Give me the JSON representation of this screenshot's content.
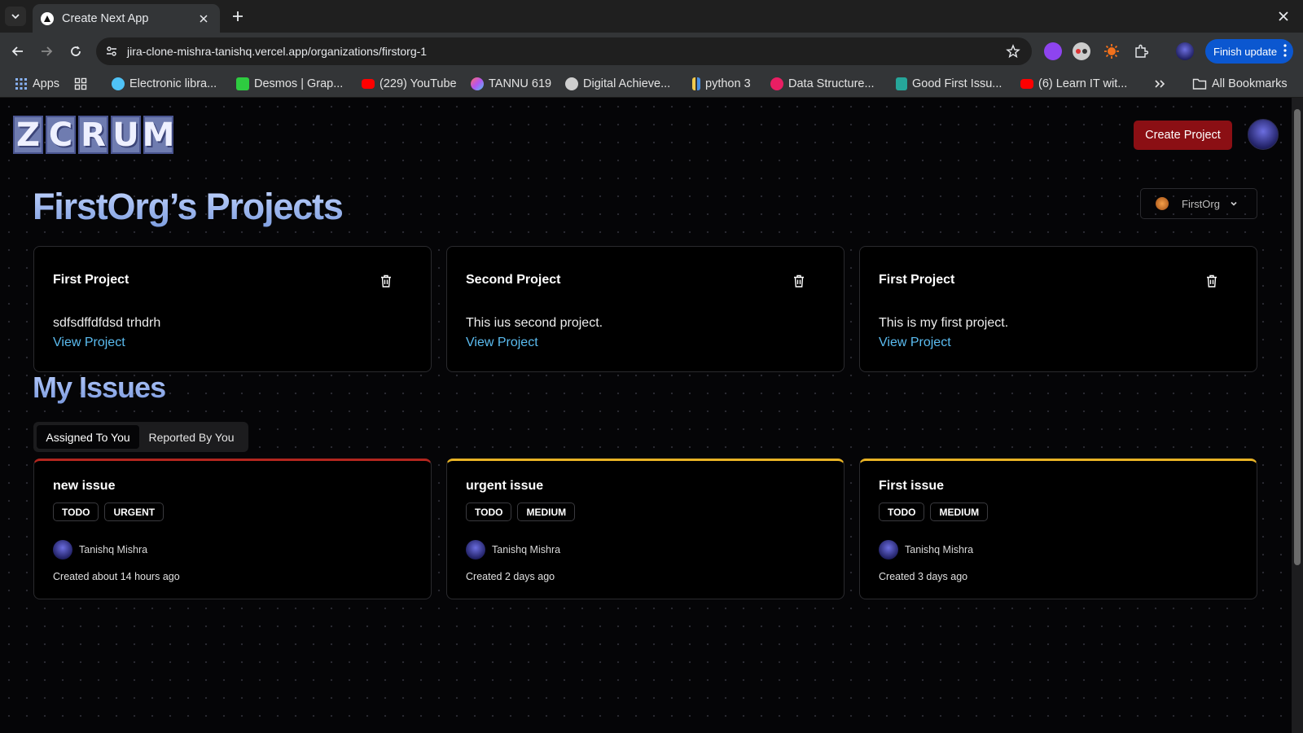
{
  "browser": {
    "tab_title": "Create Next App",
    "url": "jira-clone-mishra-tanishq.vercel.app/organizations/firstorg-1",
    "finish_update": "Finish update",
    "bookmarks": [
      {
        "label": "Apps",
        "icon": "apps-grid-icon",
        "color": "#8ab4f8"
      },
      {
        "label": "Electronic libra...",
        "icon": "globe-icon",
        "color": "#4fc3f7"
      },
      {
        "label": "Desmos | Grap...",
        "icon": "desmos-icon",
        "color": "#2ecc40"
      },
      {
        "label": "(229) YouTube",
        "icon": "youtube-icon",
        "color": "#ff0000"
      },
      {
        "label": "TANNU 619",
        "icon": "tannu-icon",
        "color": "#b455f0"
      },
      {
        "label": "Digital Achieve...",
        "icon": "digital-icon",
        "color": "#cfcfcf"
      },
      {
        "label": "python 3",
        "icon": "python-icon",
        "color": "#f2c94c"
      },
      {
        "label": "Data Structure...",
        "icon": "data-structure-icon",
        "color": "#e91e63"
      },
      {
        "label": "Good First Issu...",
        "icon": "gfi-icon",
        "color": "#26a69a"
      },
      {
        "label": "(6) Learn IT wit...",
        "icon": "youtube-icon",
        "color": "#ff0000"
      }
    ],
    "all_bookmarks": "All Bookmarks"
  },
  "header": {
    "logo_letters": [
      "Z",
      "C",
      "R",
      "U",
      "M"
    ],
    "create_project": "Create Project"
  },
  "org": {
    "title": "FirstOrg’s Projects",
    "selector_label": "FirstOrg"
  },
  "projects": [
    {
      "name": "First Project",
      "description": "sdfsdffdfdsd trhdrh",
      "link": "View Project"
    },
    {
      "name": "Second Project",
      "description": "This ius second project.",
      "link": "View Project"
    },
    {
      "name": "First Project",
      "description": "This is my first project.",
      "link": "View Project"
    }
  ],
  "issues_section": {
    "title": "My Issues",
    "tabs": [
      {
        "label": "Assigned To You",
        "active": true
      },
      {
        "label": "Reported By You",
        "active": false
      }
    ]
  },
  "issues": [
    {
      "title": "new issue",
      "status": "TODO",
      "priority": "URGENT",
      "priority_color": "#b3261e",
      "assignee": "Tanishq Mishra",
      "created": "Created about 14 hours ago"
    },
    {
      "title": "urgent issue",
      "status": "TODO",
      "priority": "MEDIUM",
      "priority_color": "#e8b325",
      "assignee": "Tanishq Mishra",
      "created": "Created 2 days ago"
    },
    {
      "title": "First issue",
      "status": "TODO",
      "priority": "MEDIUM",
      "priority_color": "#e8b325",
      "assignee": "Tanishq Mishra",
      "created": "Created 3 days ago"
    }
  ],
  "colors": {
    "accent_red": "#8b0f14",
    "link_blue": "#5bbcf0",
    "title_gradient_top": "#c4d6ff",
    "title_gradient_bottom": "#7e9ee0"
  }
}
